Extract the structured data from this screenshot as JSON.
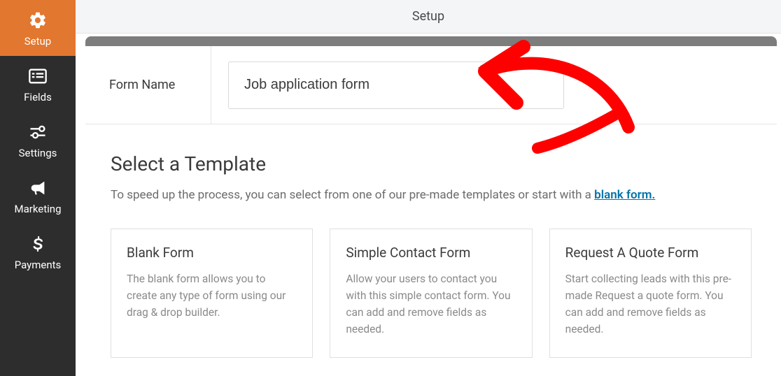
{
  "header": {
    "title": "Setup"
  },
  "sidebar": {
    "items": [
      {
        "label": "Setup",
        "icon": "gear-icon",
        "active": true
      },
      {
        "label": "Fields",
        "icon": "list-icon",
        "active": false
      },
      {
        "label": "Settings",
        "icon": "sliders-icon",
        "active": false
      },
      {
        "label": "Marketing",
        "icon": "bullhorn-icon",
        "active": false
      },
      {
        "label": "Payments",
        "icon": "dollar-icon",
        "active": false
      }
    ]
  },
  "form_name": {
    "label": "Form Name",
    "value": "Job application form"
  },
  "templates": {
    "heading": "Select a Template",
    "desc_pre": "To speed up the process, you can select from one of our pre-made templates or start with a ",
    "desc_link": "blank form.",
    "cards": [
      {
        "title": "Blank Form",
        "desc": "The blank form allows you to create any type of form using our drag & drop builder."
      },
      {
        "title": "Simple Contact Form",
        "desc": "Allow your users to contact you with this simple contact form. You can add and remove fields as needed."
      },
      {
        "title": "Request A Quote Form",
        "desc": "Start collecting leads with this pre-made Request a quote form. You can add and remove fields as needed."
      }
    ]
  }
}
